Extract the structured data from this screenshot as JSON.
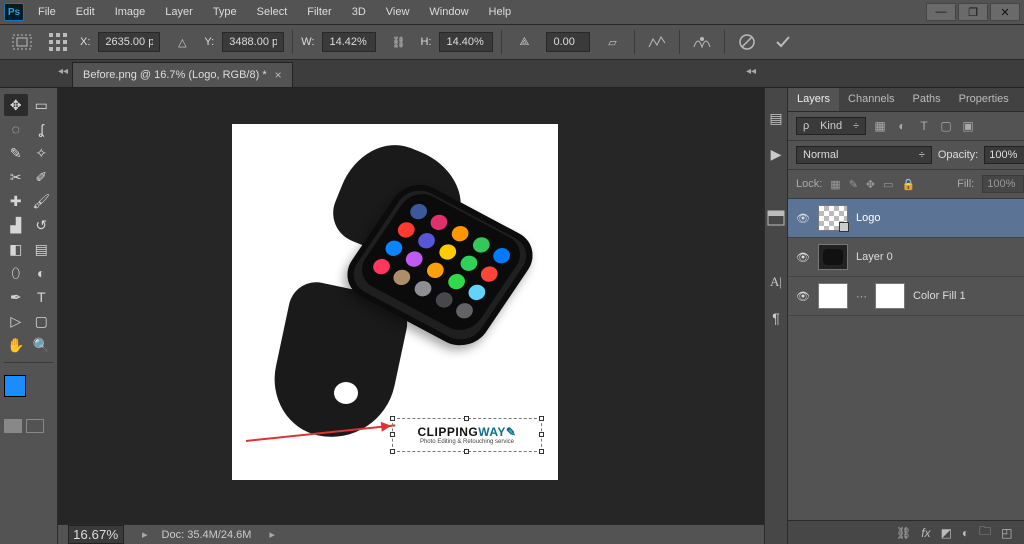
{
  "menu": {
    "items": [
      "File",
      "Edit",
      "Image",
      "Layer",
      "Type",
      "Select",
      "Filter",
      "3D",
      "View",
      "Window",
      "Help"
    ]
  },
  "app_logo": "Ps",
  "window_controls": {
    "minimize": "—",
    "maximize": "❐",
    "close": "✕"
  },
  "options": {
    "x_label": "X:",
    "x": "2635.00 p",
    "y_label": "Y:",
    "y": "3488.00 p",
    "w_label": "W:",
    "w": "14.42%",
    "h_label": "H:",
    "h": "14.40%",
    "angle_label": "",
    "angle": "0.00"
  },
  "doc_tab": {
    "title": "Before.png @ 16.7% (Logo, RGB/8) *"
  },
  "status": {
    "zoom": "16.67%",
    "doc_label": "Doc:",
    "doc": "35.4M/24.6M"
  },
  "panels": {
    "tabs": [
      "Layers",
      "Channels",
      "Paths",
      "Properties"
    ],
    "kind_label": "Kind",
    "kind_value": "",
    "blend": "Normal",
    "opacity_label": "Opacity:",
    "opacity": "100%",
    "lock_label": "Lock:",
    "fill_label": "Fill:",
    "fill": "100%"
  },
  "layers": [
    {
      "name": "Logo",
      "selected": true,
      "thumb": "checker",
      "smart": true
    },
    {
      "name": "Layer 0",
      "selected": false,
      "thumb": "watch"
    },
    {
      "name": "Color Fill 1",
      "selected": false,
      "thumb": "fill",
      "mask": true
    }
  ],
  "logo": {
    "main1": "CLIPPING",
    "main2": "WAY",
    "sub": "Photo Editing & Retouching service"
  },
  "search_icon": "🔍"
}
